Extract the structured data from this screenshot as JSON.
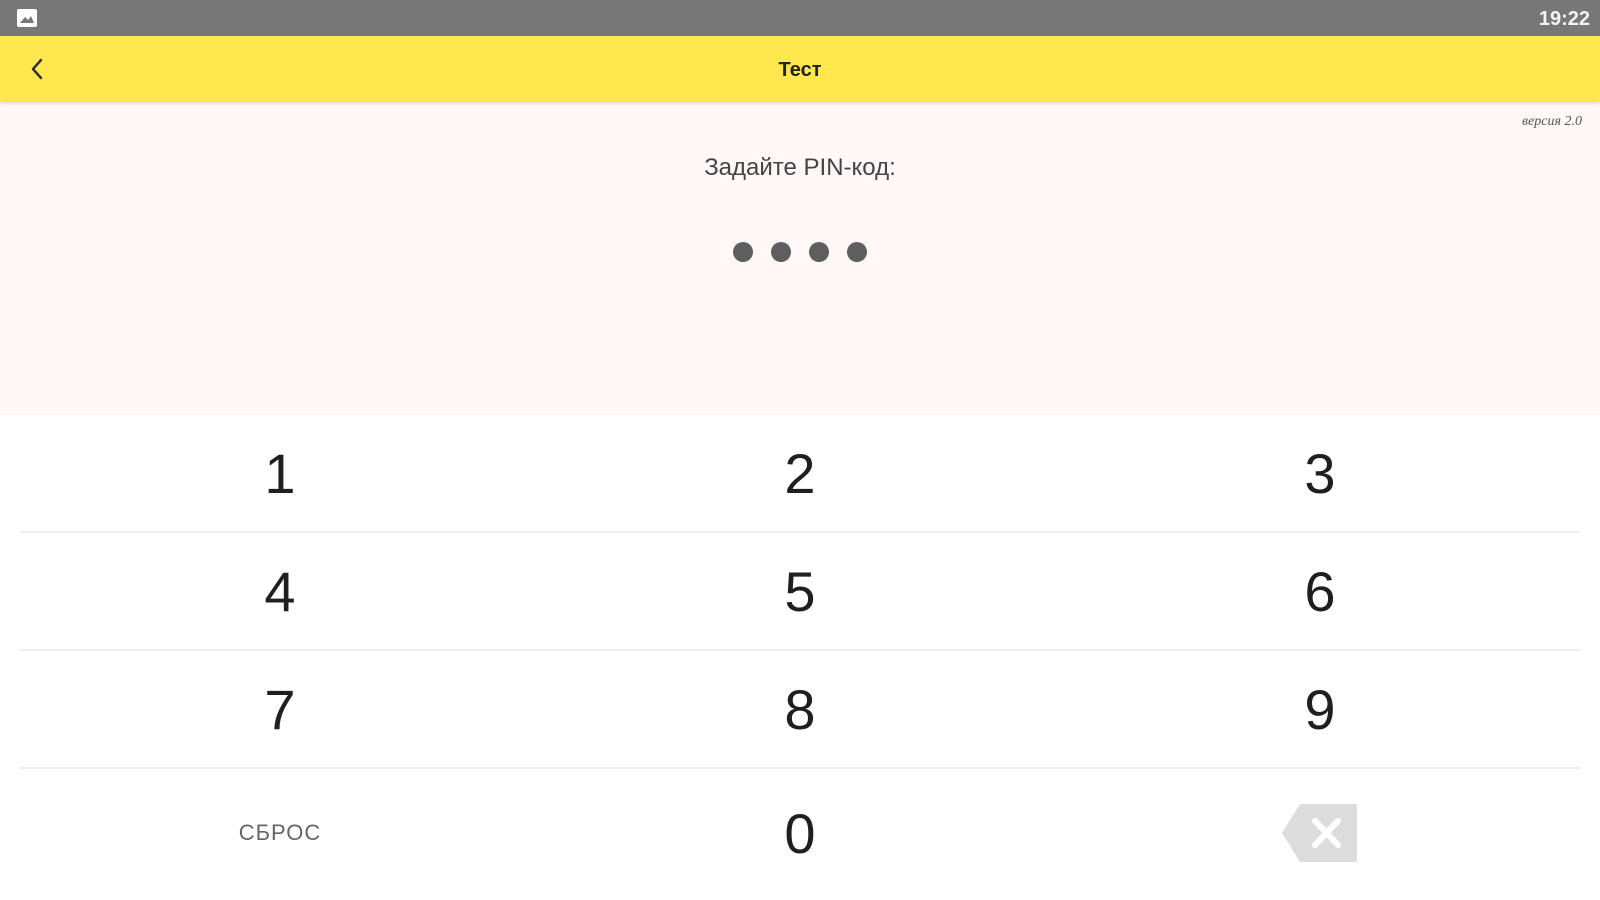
{
  "status_bar": {
    "time": "19:22",
    "left_icon": "image-icon"
  },
  "toolbar": {
    "back_icon": "chevron-left-icon",
    "title": "Тест"
  },
  "pin": {
    "version": "версия 2.0",
    "prompt": "Задайте PIN-код:",
    "entered_digits": 4
  },
  "keypad": {
    "rows": [
      [
        "1",
        "2",
        "3"
      ],
      [
        "4",
        "5",
        "6"
      ],
      [
        "7",
        "8",
        "9"
      ]
    ],
    "reset_label": "СБРОС",
    "zero_label": "0",
    "backspace_icon": "backspace-icon"
  },
  "colors": {
    "toolbar": "#ffe84f",
    "status_bar": "#777777",
    "pin_background": "#fff8f7",
    "dot": "#5e5e5e"
  }
}
